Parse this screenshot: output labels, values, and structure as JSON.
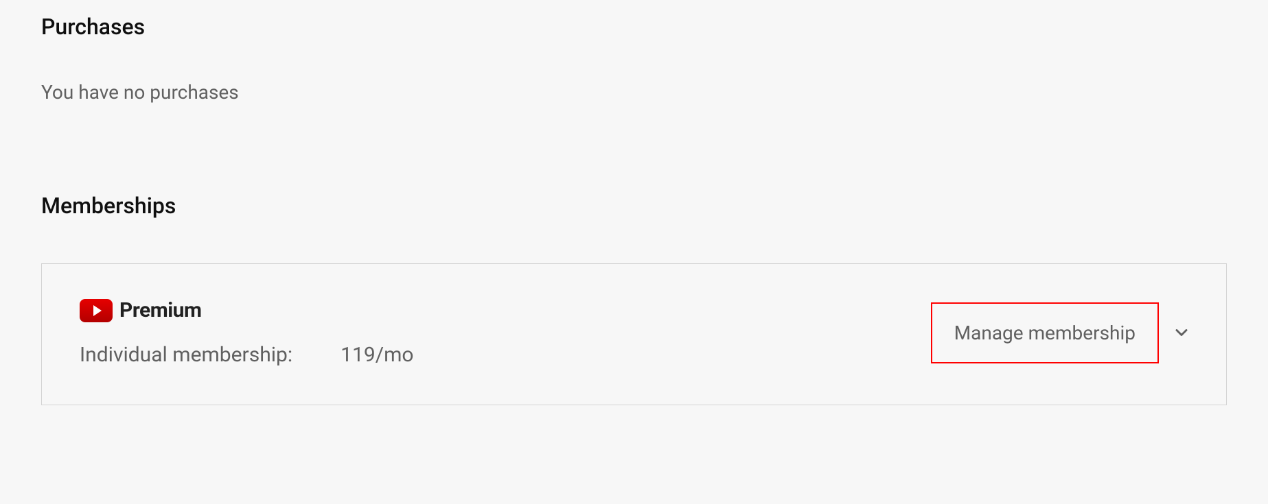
{
  "purchases": {
    "title": "Purchases",
    "empty_text": "You have no purchases"
  },
  "memberships": {
    "title": "Memberships",
    "card": {
      "brand": "Premium",
      "plan_label": "Individual membership:",
      "price": "119/mo",
      "manage_label": "Manage membership"
    }
  },
  "colors": {
    "highlight_box": "#ff0000",
    "brand_red_top": "#e60000",
    "brand_red_bottom": "#b30000",
    "text_primary": "#0f0f0f",
    "text_secondary": "#606060",
    "border": "#d3d3d3",
    "bg": "#f7f7f7"
  }
}
